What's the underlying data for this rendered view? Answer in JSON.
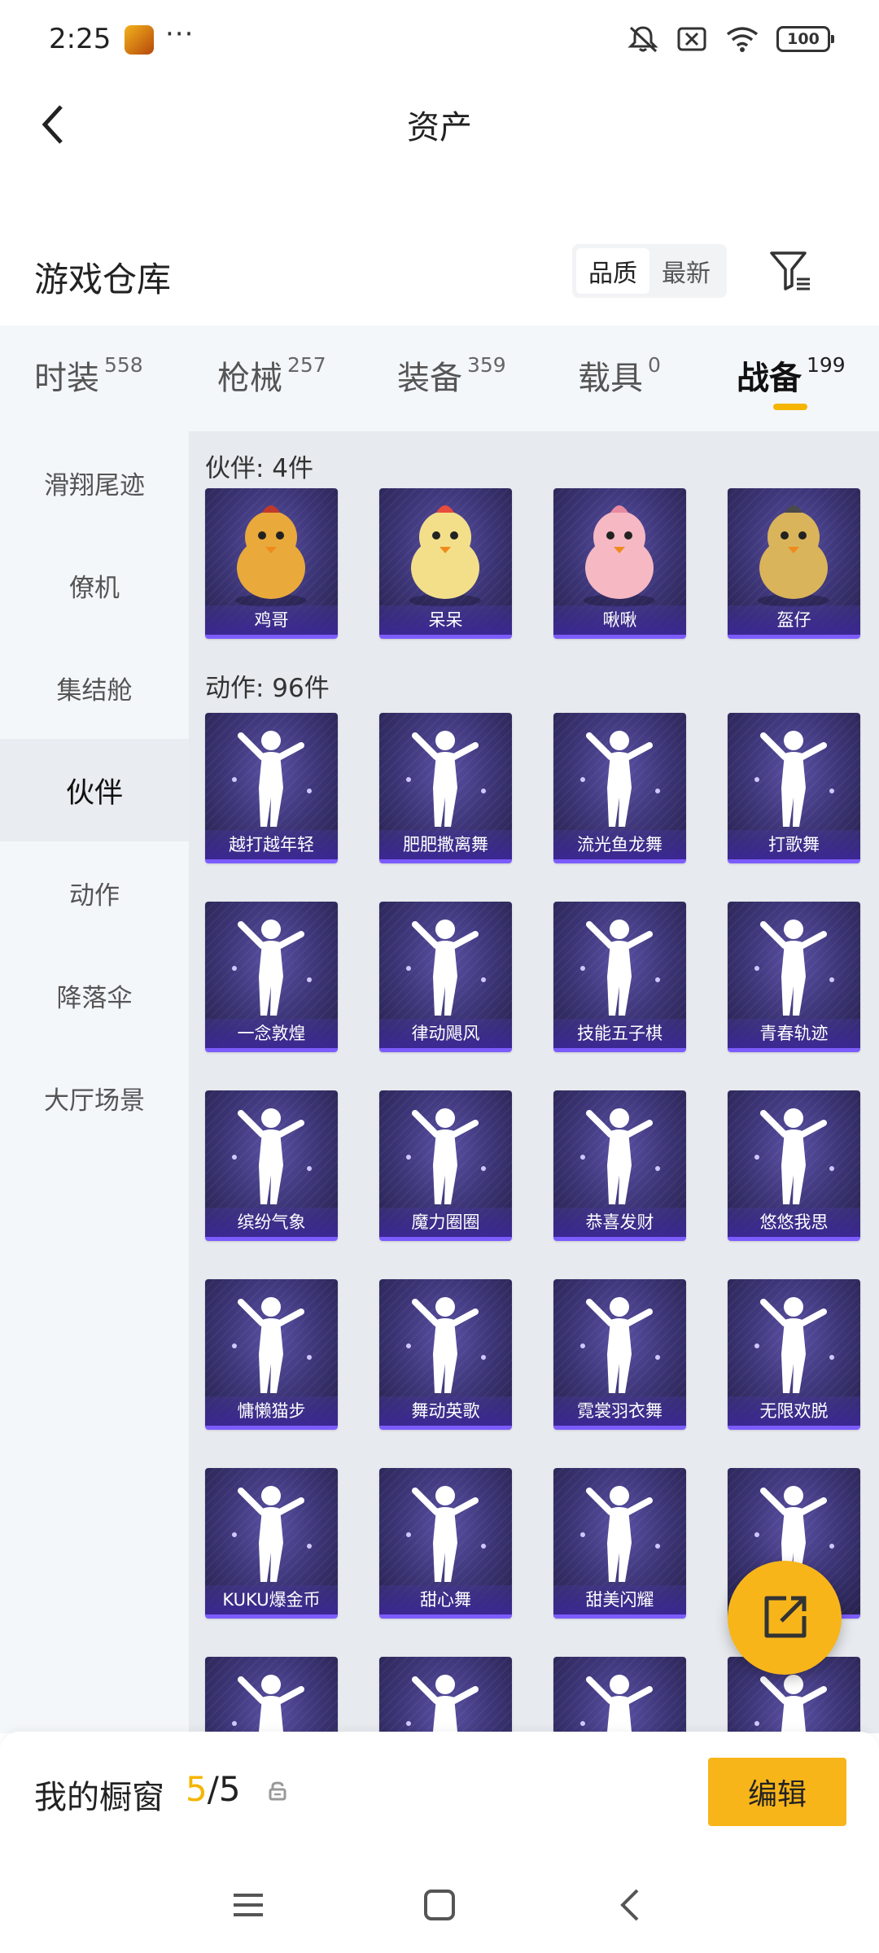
{
  "status": {
    "time": "2:25",
    "more": "···",
    "battery": "100"
  },
  "nav": {
    "title": "资产"
  },
  "section": {
    "title": "游戏仓库",
    "sort_options": [
      "品质",
      "最新"
    ],
    "sort_active": "品质"
  },
  "tabs": [
    {
      "label": "时装",
      "count": "558"
    },
    {
      "label": "枪械",
      "count": "257"
    },
    {
      "label": "装备",
      "count": "359"
    },
    {
      "label": "载具",
      "count": "0"
    },
    {
      "label": "战备",
      "count": "199",
      "active": true
    }
  ],
  "sidebar": {
    "items": [
      {
        "label": "滑翔尾迹"
      },
      {
        "label": "僚机"
      },
      {
        "label": "集结舱"
      },
      {
        "label": "伙伴",
        "active": true
      },
      {
        "label": "动作"
      },
      {
        "label": "降落伞"
      },
      {
        "label": "大厅场景"
      }
    ]
  },
  "groups": {
    "companions": {
      "title": "伙伴: 4件",
      "items": [
        "鸡哥",
        "呆呆",
        "啾啾",
        "盔仔"
      ]
    },
    "actions": {
      "title": "动作: 96件",
      "items": [
        "越打越年轻",
        "肥肥撒离舞",
        "流光鱼龙舞",
        "打歌舞",
        "一念敦煌",
        "律动飓风",
        "技能五子棋",
        "青春轨迹",
        "缤纷气象",
        "魔力圈圈",
        "恭喜发财",
        "悠悠我思",
        "慵懒猫步",
        "舞动英歌",
        "霓裳羽衣舞",
        "无限欢脱",
        "KUKU爆金币",
        "甜心舞",
        "甜美闪耀",
        ""
      ]
    }
  },
  "showcase": {
    "label": "我的橱窗",
    "current": "5",
    "separator": "/",
    "max": "5",
    "edit_label": "编辑"
  },
  "icons": {
    "back": "chevron-left-icon",
    "filter": "filter-icon",
    "share": "share-icon",
    "lock": "lock-icon"
  },
  "colors": {
    "accent": "#f5b500",
    "card_bg": "#3c3577",
    "card_border": "#7c5cff"
  }
}
